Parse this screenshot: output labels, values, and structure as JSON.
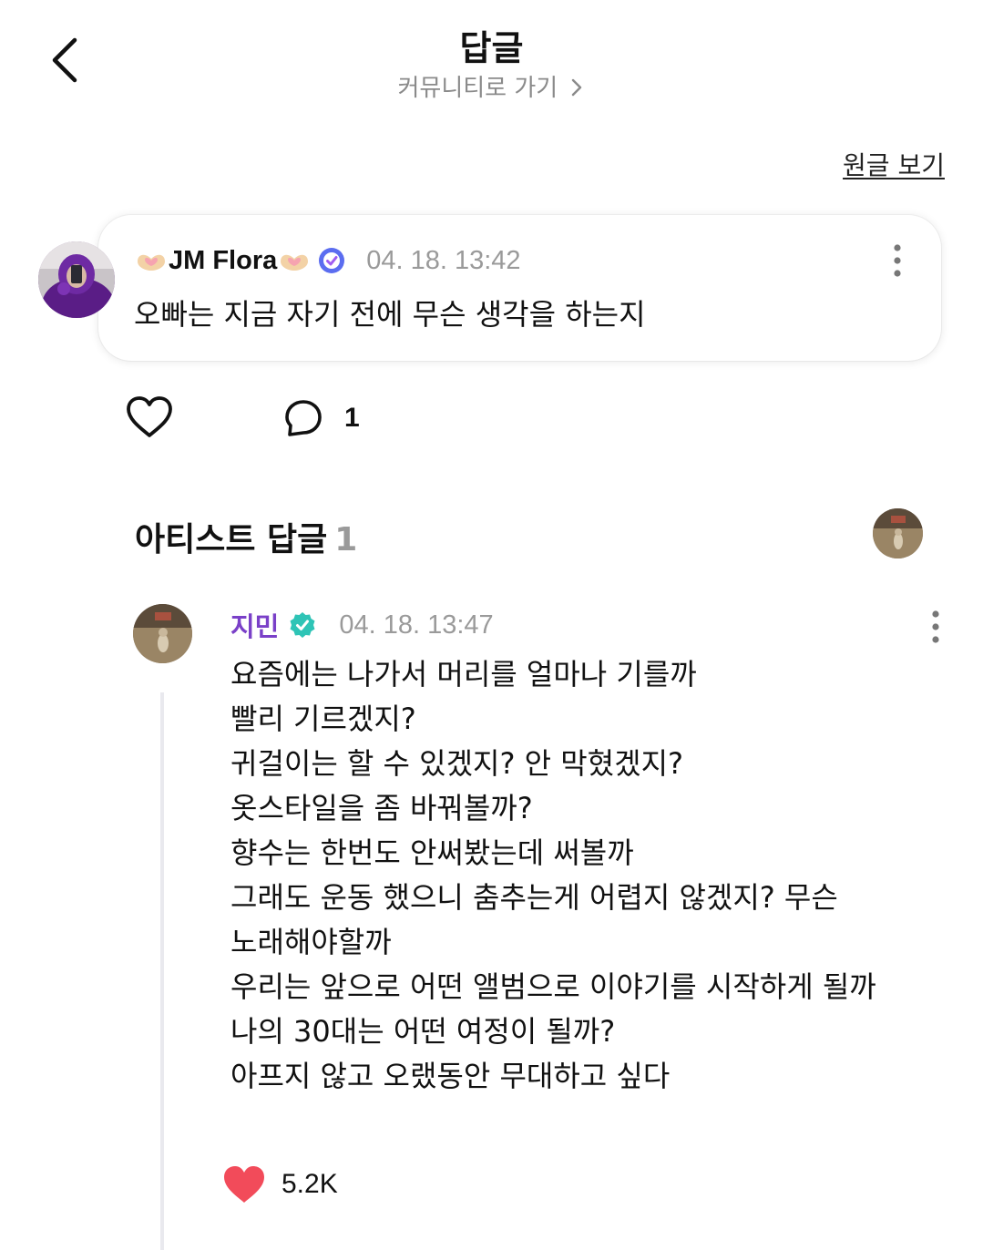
{
  "header": {
    "title": "답글",
    "community_link": "커뮤니티로 가기",
    "view_original": "원글 보기"
  },
  "fan_comment": {
    "author": "JM Flora",
    "date": "04. 18. 13:42",
    "text": "오빠는 지금 자기 전에 무슨 생각을 하는지",
    "reply_count": "1"
  },
  "artist_section": {
    "heading": "아티스트 답글",
    "count": "1"
  },
  "artist_reply": {
    "author": "지민",
    "date": "04. 18. 13:47",
    "lines": [
      "요즘에는 나가서 머리를 얼마나 기를까",
      "빨리 기르겠지?",
      "귀걸이는 할 수 있겠지? 안 막혔겠지?",
      "옷스타일을 좀 바꿔볼까?",
      "향수는 한번도 안써봤는데 써볼까",
      "그래도 운동 했으니 춤추는게 어렵지 않겠지? 무슨",
      "노래해야할까",
      "우리는 앞으로 어떤 앨범으로 이야기를 시작하게 될까",
      "나의 30대는 어떤 여정이 될까?",
      "아프지 않고 오랬동안 무대하고 싶다"
    ],
    "like_count": "5.2K"
  },
  "colors": {
    "artist_name": "#7a40c8",
    "verified_badge": "#2ec4b6",
    "fan_badge": "#6c5ce7",
    "liked_heart": "#f24b5a",
    "muted_text": "#9a9a9a"
  },
  "icons": {
    "back": "chevron-left-icon",
    "community_arrow": "chevron-right-icon",
    "more": "more-vertical-icon",
    "like": "heart-outline-icon",
    "reply": "speech-bubble-icon",
    "artist_like": "heart-filled-icon",
    "fan_verified": "verified-badge-icon",
    "artist_verified": "artist-verified-badge-icon"
  }
}
